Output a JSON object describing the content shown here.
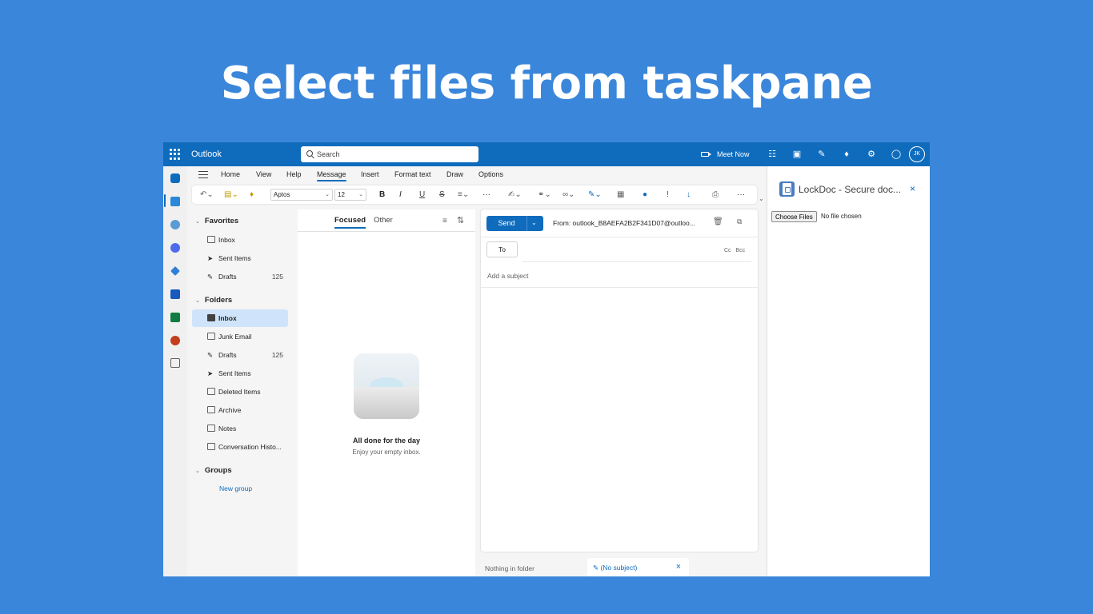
{
  "headline": "Select files from taskpane",
  "topbar": {
    "app_name": "Outlook",
    "search_placeholder": "Search",
    "meet_now": "Meet Now",
    "avatar_initials": "JK",
    "accent": "#0f6cbd"
  },
  "ribbon": {
    "tabs": [
      "Home",
      "View",
      "Help",
      "Message",
      "Insert",
      "Format text",
      "Draw",
      "Options"
    ],
    "active_tab": "Message",
    "font_name": "Aptos",
    "font_size": "12",
    "more": "···"
  },
  "folders": {
    "favorites_label": "Favorites",
    "favorites": [
      {
        "label": "Inbox",
        "count": ""
      },
      {
        "label": "Sent Items",
        "count": ""
      },
      {
        "label": "Drafts",
        "count": "125"
      }
    ],
    "folders_label": "Folders",
    "folders": [
      {
        "label": "Inbox",
        "count": ""
      },
      {
        "label": "Junk Email",
        "count": ""
      },
      {
        "label": "Drafts",
        "count": "125"
      },
      {
        "label": "Sent Items",
        "count": ""
      },
      {
        "label": "Deleted Items",
        "count": ""
      },
      {
        "label": "Archive",
        "count": ""
      },
      {
        "label": "Notes",
        "count": ""
      },
      {
        "label": "Conversation Histo...",
        "count": ""
      }
    ],
    "groups_label": "Groups",
    "new_group": "New group"
  },
  "message_list": {
    "tab_focused": "Focused",
    "tab_other": "Other",
    "empty_title": "All done for the day",
    "empty_subtitle": "Enjoy your empty inbox."
  },
  "compose": {
    "send": "Send",
    "from": "From: outlook_B8AEFA2B2F341D07@outloo...",
    "to": "To",
    "cc": "Cc",
    "bcc": "Bcc",
    "subject_placeholder": "Add a subject"
  },
  "bottom": {
    "nothing_in_folder": "Nothing in folder",
    "draft_tab": "(No subject)"
  },
  "taskpane": {
    "title": "LockDoc - Secure doc...",
    "choose_files": "Choose Files",
    "no_file": "No file chosen"
  }
}
